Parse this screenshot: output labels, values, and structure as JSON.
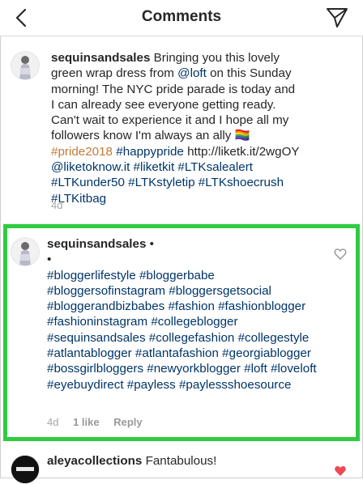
{
  "header": {
    "title": "Comments"
  },
  "caption": {
    "username": "sequinsandsales",
    "text_1": " Bringing you this lovely green wrap dress from ",
    "mention_loft": "@loft",
    "text_2": " on this Sunday morning! The NYC pride parade is today and I can already see everyone getting ready. Can't wait to experience it and I hope all my followers know I'm always an ally ",
    "flag_emoji": "🏳️‍🌈",
    "tag_pride": "#pride2018",
    "tag_happypride": "#happypride",
    "url": " http://liketk.it/2wgOY ",
    "mention_liketoknow": "@liketoknow.it",
    "tags_rest": " #liketkit #LTKsalealert #LTKunder50 #LTKstyletip #LTKshoecrush #LTKitbag",
    "time": "4d"
  },
  "highlighted_comment": {
    "username": "sequinsandsales",
    "bullet": "•",
    "bullet2": "•",
    "hashtags": "#bloggerlifestyle #bloggerbabe #bloggersofinstagram #bloggersgetsocial #bloggerandbizbabes #fashion #fashionblogger #fashioninstagram #collegeblogger #sequinsandsales #collegefashion #collegestyle #atlantablogger #atlantafashion #georgiablogger #bossgirlbloggers #newyorkblogger #loft #loveloft #eyebuydirect #payless #paylessshoesource",
    "time": "4d",
    "likes": "1 like",
    "reply": "Reply"
  },
  "next_comment": {
    "username": "aleyacollections",
    "text": " Fantabulous!"
  },
  "colors": {
    "highlight": "#2ecc40",
    "link": "#003569",
    "heart_liked": "#ed4956"
  },
  "icons": [
    "back-arrow-icon",
    "direct-send-icon",
    "heart-outline-icon",
    "heart-filled-icon"
  ]
}
